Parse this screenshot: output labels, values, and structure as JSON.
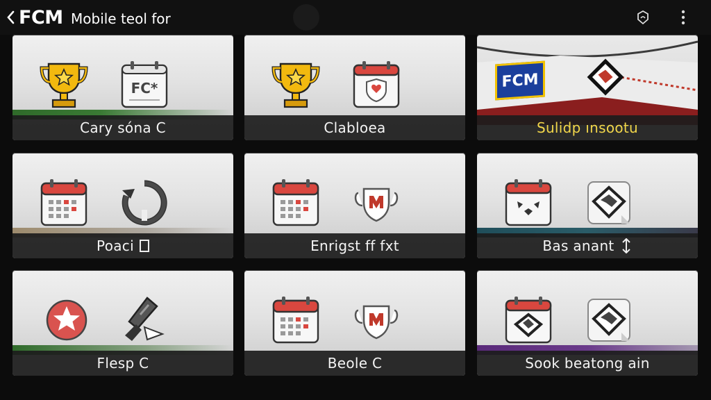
{
  "header": {
    "brand": "FCM",
    "subtitle": "Mobile teol for"
  },
  "tiles": [
    {
      "label": "Cary sóna C",
      "left_icon": "trophy-icon",
      "right_icon": "fc-calendar-icon"
    },
    {
      "label": "Clabloea",
      "left_icon": "trophy-icon",
      "right_icon": "shield-calendar-icon"
    },
    {
      "label": "Sulidp ınsootu",
      "left_icon": "fcm-banner-icon",
      "right_icon": "shield-badge-icon",
      "banner_text": "FCM"
    },
    {
      "label": "Poaci",
      "left_icon": "calendar-icon",
      "right_icon": "refresh-icon"
    },
    {
      "label": "Enrigst ff fxt",
      "left_icon": "calendar-icon",
      "right_icon": "club-crest-icon"
    },
    {
      "label": "Bas anant",
      "left_icon": "calendar-face-icon",
      "right_icon": "shield-badge-icon"
    },
    {
      "label": "Flesp C",
      "left_icon": "star-badge-icon",
      "right_icon": "whistle-icon"
    },
    {
      "label": "Beole C",
      "left_icon": "calendar-icon",
      "right_icon": "club-crest-icon"
    },
    {
      "label": "Sook beatong ain",
      "left_icon": "shield-calendar-icon",
      "right_icon": "shield-badge-icon"
    }
  ],
  "colors": {
    "accent_gold": "#f5c518",
    "caption_gold": "#f2d64a",
    "calendar_red": "#d9473f",
    "stripe_green": "#2f6b2a",
    "stripe_red": "#8a1e1e",
    "stripe_teal": "#1f4e5a",
    "stripe_purple": "#5a2a7a",
    "banner_blue": "#1b3f9c"
  }
}
